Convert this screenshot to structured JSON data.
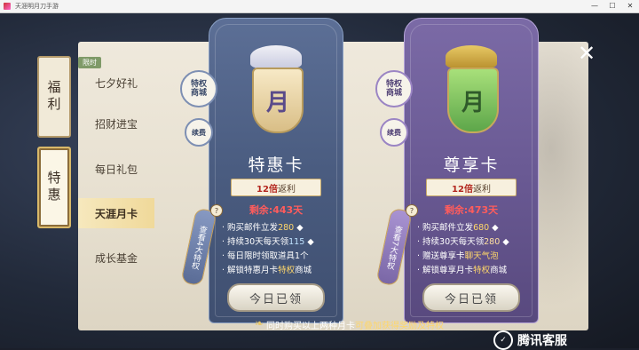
{
  "window": {
    "title": "天涯明月刀手游",
    "controls": [
      "—",
      "☐",
      "✕"
    ]
  },
  "categories": [
    {
      "label": "福利",
      "active": false
    },
    {
      "label": "特惠",
      "active": true
    }
  ],
  "submenu": {
    "badge": "限时",
    "items": [
      {
        "label": "七夕好礼",
        "active": false
      },
      {
        "label": "招财进宝",
        "active": false
      },
      {
        "label": "每日礼包",
        "active": false
      },
      {
        "label": "天涯月卡",
        "active": true
      },
      {
        "label": "成长基金",
        "active": false
      }
    ]
  },
  "cards": [
    {
      "tag_top": "特权\n商城",
      "tag_renew": "续费",
      "emblem": "月",
      "title": "特惠卡",
      "ribbon_num": "12倍",
      "ribbon_text": "返利",
      "remain": "剩余:443天",
      "side_tag": "查看4大特权",
      "benefits": [
        {
          "pre": "购买邮件立发",
          "val": "280"
        },
        {
          "pre": "持续30天每天领",
          "val": "115"
        },
        {
          "pre": "每日限时领取道具1个",
          "val": ""
        },
        {
          "pre": "解锁特惠月卡",
          "hl": "特权",
          "post": "商城"
        }
      ],
      "claim": "今日已领"
    },
    {
      "tag_top": "特权\n商城",
      "tag_renew": "续费",
      "emblem": "月",
      "title": "尊享卡",
      "ribbon_num": "12倍",
      "ribbon_text": "返利",
      "remain": "剩余:473天",
      "side_tag": "查看7大特权",
      "benefits": [
        {
          "pre": "购买邮件立发",
          "val": "680"
        },
        {
          "pre": "持续30天每天领",
          "val": "280"
        },
        {
          "pre": "赠送尊享卡",
          "hl": "聊天气泡",
          "post": ""
        },
        {
          "pre": "解锁尊享月卡",
          "hl": "特权",
          "post": "商城"
        }
      ],
      "claim": "今日已领"
    }
  ],
  "footer": {
    "text": "同时购买以上两种月卡",
    "highlight": "可叠加获得奖励及特权"
  },
  "brand": "腾讯客服",
  "icons": {
    "close": "close-icon",
    "renew": "renew-icon",
    "currency": "currency-icon",
    "question": "question-icon"
  }
}
